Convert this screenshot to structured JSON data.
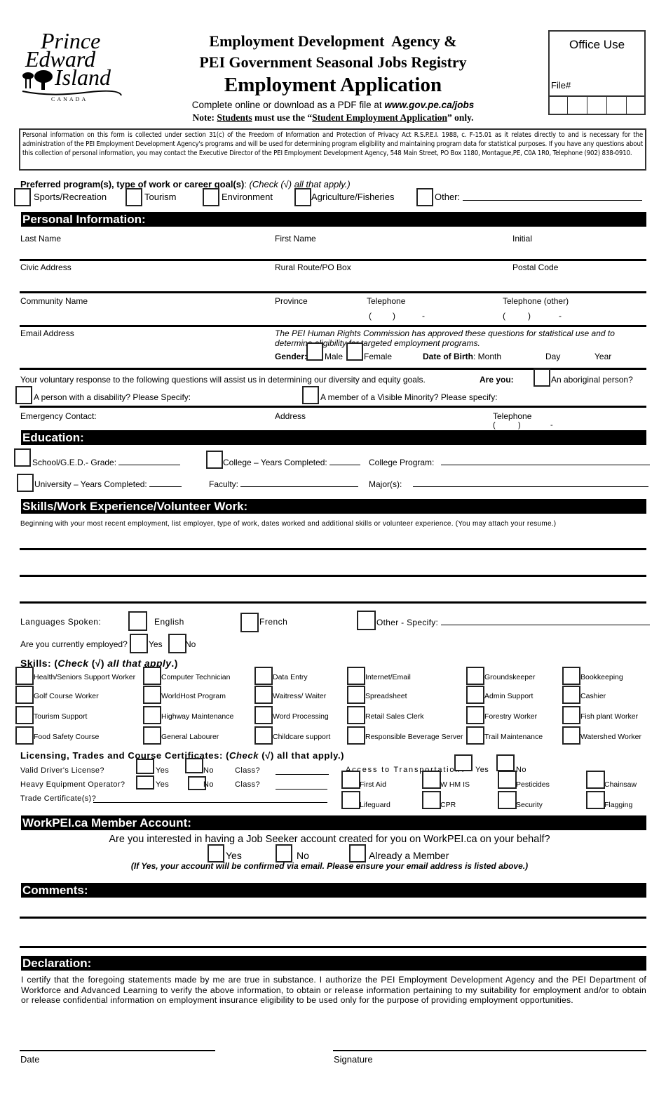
{
  "header": {
    "logo": {
      "line1": "Prince",
      "line2": "Edward",
      "line3": "Island",
      "country": "CANADA"
    },
    "title_line1": "Employment Development  Agency &",
    "title_line2": "PEI Government Seasonal Jobs Registry",
    "title_main": "Employment Application",
    "download_text": "Complete online or download as a PDF file at ",
    "download_url": "www.gov.pe.ca/jobs",
    "note_prefix": "Note: ",
    "note_students": "Students",
    "note_middle": " must use the “",
    "note_form": "Student Employment Application",
    "note_suffix": "” only.",
    "office_use": {
      "title": "Office Use",
      "file_label": "File#"
    }
  },
  "privacy_notice": "Personal information on this form is collected under section 31(c) of the Freedom of Information and Protection of Privacy Act R.S.P.E.I. 1988, c. F-15.01 as it relates directly to and is necessary for the administration of the PEI Employment Development Agency's programs and will be used for determining program eligibility and maintaining program data for statistical purposes. If you have any questions about this collection of personal information, you may contact the Executive Director of the PEI Employment Development Agency, 548 Main Street, PO Box 1180, Montague,PE, C0A 1R0, Telephone (902) 838-0910.",
  "preferred": {
    "label": "Preferred program(s), type of work or career goal(s)",
    "hint": "(Check (√) all that apply.)",
    "options": [
      "Sports/Recreation",
      "Tourism",
      "Environment",
      "Agriculture/Fisheries",
      "Other:"
    ]
  },
  "personal": {
    "heading": "Personal Information:",
    "last_name": "Last Name",
    "first_name": "First Name",
    "initial": "Initial",
    "civic_address": "Civic Address",
    "rural_route": "Rural Route/PO Box",
    "postal_code": "Postal Code",
    "community": "Community Name",
    "province": "Province",
    "telephone": "Telephone",
    "telephone_other": "Telephone (other)",
    "phone_mask_open": "(",
    "phone_mask_close": ")",
    "phone_mask_dash": "-",
    "email": "Email Address",
    "hr_notice": "The PEI Human Rights Commission has approved these questions for statistical use and to determine eligibility for targeted employment programs.",
    "gender_label": "Gender:",
    "gender_options": [
      "Male",
      "Female"
    ],
    "dob_label": "Date of Birth",
    "dob_month": "Month",
    "dob_day": "Day",
    "dob_year": "Year",
    "voluntary": "Your voluntary response to the following questions will assist us in determining our diversity and equity goals.",
    "are_you": "Are you:",
    "aboriginal": "An aboriginal person?",
    "disability": "A person with a disability?  Please Specify:",
    "minority": "A member of a Visible Minority?  Please specify:",
    "emergency": "Emergency Contact:",
    "address": "Address",
    "emergency_phone": "Telephone"
  },
  "education": {
    "heading": "Education:",
    "school": "School/G.E.D.- Grade:",
    "college_years": "College – Years Completed:",
    "college_program": "College Program:",
    "university_years": "University – Years Completed:",
    "faculty": "Faculty:",
    "majors": "Major(s):"
  },
  "experience": {
    "heading": "Skills/Work Experience/Volunteer Work:",
    "instructions": "Beginning with your most recent employment, list employer, type of work, dates worked and additional skills or volunteer experience. (You may attach your resume.)"
  },
  "languages": {
    "label": "Languages Spoken:",
    "options": [
      "English",
      "French",
      "Other - Specify:"
    ]
  },
  "employed": {
    "label": "Are you currently employed?",
    "options": [
      "Yes",
      "No"
    ]
  },
  "skills": {
    "label": "Skills: (",
    "check": "Check",
    "mid": " (√) ",
    "all": "all that apply",
    "end": ".)",
    "columns": [
      [
        "Health/Seniors Support Worker",
        "Golf Course Worker",
        "Tourism Support",
        "Food Safety Course"
      ],
      [
        "Computer Technician",
        "WorldHost Program",
        "Highway Maintenance",
        "General Labourer"
      ],
      [
        "Data Entry",
        "Waitress/ Waiter",
        "Word Processing",
        "Childcare support"
      ],
      [
        "Internet/Email",
        "Spreadsheet",
        "Retail Sales Clerk",
        "Responsible Beverage Server"
      ],
      [
        "Groundskeeper",
        "Admin Support",
        "Forestry Worker",
        "Trail Maintenance"
      ],
      [
        "Bookkeeping",
        "Cashier",
        "Fish plant Worker",
        "Watershed Worker"
      ]
    ]
  },
  "licensing": {
    "heading_prefix": "Licensing, Trades and Course Certificates: (",
    "heading_check": "Check",
    "heading_suffix": " (√) all that apply.)",
    "drivers": "Valid Driver's License?",
    "heavy": "Heavy Equipment Operator?",
    "trade": "Trade Certificate(s)?",
    "yes": "Yes",
    "no": "No",
    "class": "Class?",
    "transport": "Access to Transportation?",
    "certs": [
      [
        "First Aid",
        "Lifeguard"
      ],
      [
        "W HM IS",
        "CPR"
      ],
      [
        "Pesticides",
        "Security"
      ],
      [
        "Chainsaw",
        "Flagging"
      ]
    ]
  },
  "workpei": {
    "heading": "WorkPEI.ca Member Account:",
    "question": "Are you interested in having a Job Seeker account created for you on WorkPEI.ca on your behalf?",
    "options": [
      "Yes",
      "No",
      "Already a Member"
    ],
    "note": "(If Yes, your account will be confirmed via email.  Please ensure your email address is listed above.)"
  },
  "comments": {
    "heading": "Comments:"
  },
  "declaration": {
    "heading": "Declaration:",
    "text": "I certify that the foregoing statements made by me are true in substance. I authorize the PEI Employment Development Agency and the PEI Department of Workforce and Advanced Learning to verify the above information, to obtain or release information pertaining to my suitability for employment and/or to obtain or release confidential information on employment insurance eligibility to be used only for the purpose of providing employment opportunities.",
    "date": "Date",
    "signature": "Signature"
  }
}
